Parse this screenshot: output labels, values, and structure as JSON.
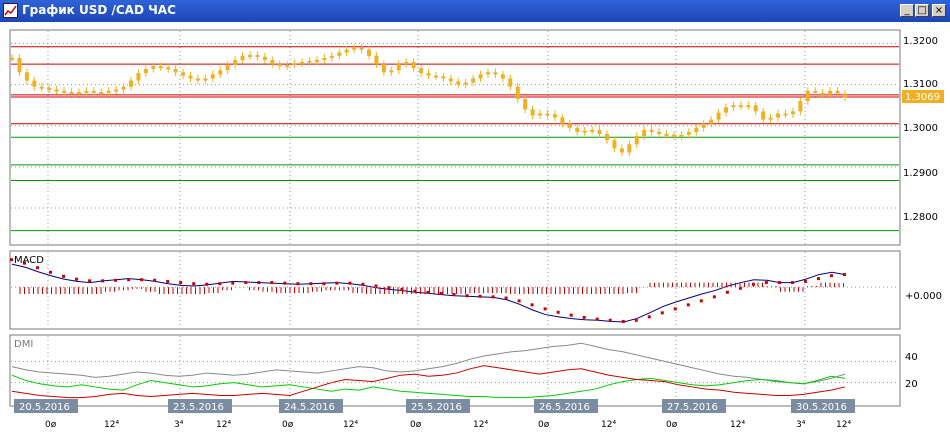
{
  "window": {
    "title": "График USD /CAD  ЧАС",
    "buttons": {
      "minimize": "_",
      "maximize": "□",
      "close": "×"
    }
  },
  "colors": {
    "price_bar": "#f0b020",
    "resistance_line": "#cc0000",
    "support_line": "#009900",
    "current_price_bg": "#f0b020",
    "macd_line": "#000080",
    "macd_signal": "#cc0000",
    "dmi_adx": "#888888",
    "dmi_plus": "#00cc00",
    "dmi_minus": "#cc0000",
    "date_label_bg": "#7a8ca0",
    "grid": "#9a9a9a"
  },
  "price_panel": {
    "current_price": "1.3069",
    "y_ticks": [
      "1.3200",
      "1.3100",
      "1.3000",
      "1.2900",
      "1.2800"
    ]
  },
  "macd_panel": {
    "label": "MACD",
    "y_ticks": [
      "+0.000"
    ]
  },
  "dmi_panel": {
    "label": "DMI",
    "y_ticks": [
      "40",
      "20"
    ]
  },
  "dates": [
    "20.5.2016",
    "23.5.2016",
    "24.5.2016",
    "25.5.2016",
    "26.5.2016",
    "27.5.2016",
    "30.5.2016"
  ],
  "hour_labels": [
    "0ø",
    "12⁴",
    "3⁴",
    "12⁴",
    "0ø",
    "12⁴",
    "0ø",
    "12⁴",
    "0ø",
    "12⁴",
    "0ø",
    "12⁴",
    "3⁴",
    "12⁴"
  ],
  "chart_data": {
    "type": "line",
    "title": "График USD /CAD  ЧАС",
    "series": [
      {
        "name": "",
        "values": [
          1.3165,
          1.313,
          1.311,
          1.3095,
          1.3092,
          1.3088,
          1.3085,
          1.3082,
          1.308,
          1.3082,
          1.3085,
          1.3082,
          1.308,
          1.3085,
          1.3088,
          1.3095,
          1.311,
          1.3128,
          1.3138,
          1.3145,
          1.3142,
          1.3138,
          1.313,
          1.3122,
          1.3115,
          1.311,
          1.3115,
          1.3125,
          1.3135,
          1.3148,
          1.316,
          1.317,
          1.3172,
          1.3168,
          1.316,
          1.315,
          1.3145,
          1.3148,
          1.3152,
          1.3155,
          1.3158,
          1.316,
          1.3165,
          1.317,
          1.3178,
          1.3185,
          1.319,
          1.3185,
          1.317,
          1.315,
          1.313,
          1.3135,
          1.315,
          1.3155,
          1.314,
          1.3128,
          1.3122,
          1.312,
          1.3115,
          1.3108,
          1.31,
          1.3105,
          1.3115,
          1.3125,
          1.313,
          1.3125,
          1.3115,
          1.3095,
          1.3065,
          1.304,
          1.3025,
          1.303,
          1.3028,
          1.302,
          1.3005,
          1.2995,
          1.2985,
          1.2988,
          1.299,
          1.298,
          1.2965,
          1.2945,
          1.2935,
          1.2955,
          1.2975,
          1.299,
          1.2985,
          1.298,
          1.2978,
          1.2975,
          1.2978,
          1.2985,
          1.2995,
          1.3005,
          1.3015,
          1.3032,
          1.3045,
          1.305,
          1.3048,
          1.305,
          1.3035,
          1.3015,
          1.302,
          1.303,
          1.3028,
          1.3035,
          1.306,
          1.3085,
          1.308,
          1.3075,
          1.3085,
          1.3078,
          1.3069
        ]
      }
    ],
    "resistance_levels": [
      1.3192,
      1.315,
      1.3075,
      1.307,
      1.3005
    ],
    "support_levels": [
      1.2972,
      1.2905,
      1.2867,
      1.2745
    ],
    "macd": {
      "macd_line": [
        0.004,
        0.0035,
        0.0027,
        0.002,
        0.0014,
        0.001,
        0.0008,
        0.0011,
        0.0013,
        0.0015,
        0.0013,
        0.001,
        0.0006,
        0.0003,
        0.0002,
        0.0004,
        0.0007,
        0.001,
        0.0009,
        0.0008,
        0.0007,
        0.0006,
        0.0005,
        0.0006,
        0.0007,
        0.0008,
        0.0006,
        0.0003,
        -0.0001,
        -0.0004,
        -0.0006,
        -0.0009,
        -0.0011,
        -0.0013,
        -0.0015,
        -0.0016,
        -0.0017,
        -0.0018,
        -0.0022,
        -0.003,
        -0.004,
        -0.0048,
        -0.0052,
        -0.0055,
        -0.0057,
        -0.0058,
        -0.006,
        -0.0061,
        -0.0055,
        -0.0045,
        -0.0034,
        -0.0026,
        -0.0019,
        -0.0012,
        -0.0006,
        0.0002,
        0.0008,
        0.0013,
        0.0012,
        0.0008,
        0.0008,
        0.0014,
        0.0022,
        0.0026,
        0.0022
      ],
      "signal_line": [
        0.0048,
        0.0042,
        0.0034,
        0.0026,
        0.0019,
        0.0014,
        0.0011,
        0.0011,
        0.0012,
        0.0013,
        0.0013,
        0.0012,
        0.001,
        0.0008,
        0.0006,
        0.0005,
        0.0006,
        0.0007,
        0.0008,
        0.0008,
        0.0008,
        0.0007,
        0.0006,
        0.0006,
        0.0006,
        0.0007,
        0.0007,
        0.0005,
        0.0002,
        -0.0001,
        -0.0004,
        -0.0007,
        -0.0009,
        -0.0011,
        -0.0013,
        -0.0015,
        -0.0016,
        -0.0017,
        -0.0019,
        -0.0024,
        -0.0031,
        -0.0038,
        -0.0044,
        -0.0049,
        -0.0053,
        -0.0056,
        -0.0058,
        -0.006,
        -0.0058,
        -0.0052,
        -0.0045,
        -0.0038,
        -0.0031,
        -0.0024,
        -0.0017,
        -0.0009,
        -0.0002,
        0.0005,
        0.0008,
        0.0008,
        0.0008,
        0.001,
        0.0015,
        0.002,
        0.0022
      ]
    },
    "dmi": {
      "adx": [
        35,
        32,
        30,
        29,
        28,
        27,
        25,
        26,
        28,
        30,
        29,
        27,
        26,
        27,
        29,
        28,
        27,
        28,
        30,
        32,
        31,
        30,
        29,
        31,
        33,
        35,
        34,
        31,
        30,
        31,
        33,
        35,
        38,
        42,
        45,
        47,
        49,
        50,
        52,
        54,
        55,
        57,
        54,
        51,
        49,
        46,
        43,
        40,
        37,
        34,
        31,
        28,
        26,
        25,
        23,
        21,
        20,
        19,
        21,
        24,
        28
      ],
      "di_plus": [
        27,
        22,
        19,
        17,
        16,
        18,
        16,
        14,
        13,
        18,
        22,
        20,
        18,
        16,
        17,
        19,
        20,
        18,
        16,
        17,
        18,
        16,
        14,
        12,
        14,
        13,
        16,
        14,
        12,
        11,
        10,
        9,
        8,
        7,
        7,
        6,
        6,
        6,
        7,
        8,
        10,
        12,
        14,
        18,
        21,
        23,
        24,
        22,
        20,
        18,
        17,
        18,
        20,
        22,
        23,
        22,
        20,
        19,
        22,
        26,
        24
      ],
      "di_minus": [
        12,
        10,
        8,
        7,
        6,
        6,
        7,
        9,
        10,
        8,
        7,
        8,
        9,
        10,
        9,
        8,
        8,
        9,
        10,
        9,
        8,
        12,
        16,
        20,
        23,
        22,
        21,
        24,
        27,
        28,
        26,
        27,
        29,
        33,
        36,
        34,
        32,
        30,
        28,
        30,
        32,
        33,
        30,
        27,
        25,
        23,
        22,
        21,
        18,
        16,
        14,
        13,
        11,
        10,
        9,
        8,
        8,
        9,
        11,
        13,
        16
      ]
    },
    "ylim": [
      1.2715,
      1.3228
    ]
  }
}
